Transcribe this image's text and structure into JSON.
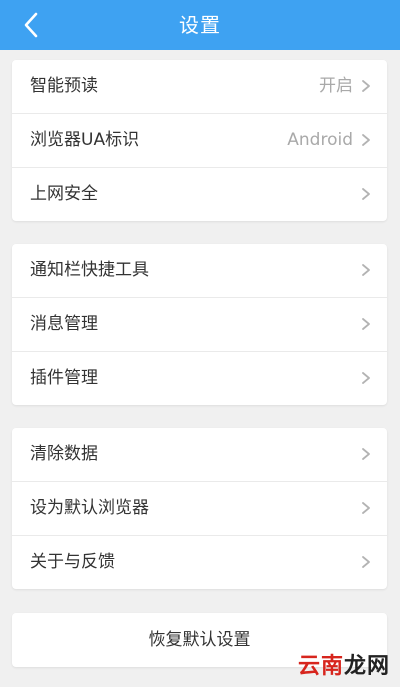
{
  "header": {
    "title": "设置",
    "back_icon": "chevron-left-icon",
    "background": "#3ea2f2"
  },
  "groups": [
    {
      "items": [
        {
          "label": "智能预读",
          "value": "开启"
        },
        {
          "label": "浏览器UA标识",
          "value": "Android"
        },
        {
          "label": "上网安全",
          "value": ""
        }
      ]
    },
    {
      "items": [
        {
          "label": "通知栏快捷工具",
          "value": ""
        },
        {
          "label": "消息管理",
          "value": ""
        },
        {
          "label": "插件管理",
          "value": ""
        }
      ]
    },
    {
      "items": [
        {
          "label": "清除数据",
          "value": ""
        },
        {
          "label": "设为默认浏览器",
          "value": ""
        },
        {
          "label": "关于与反馈",
          "value": ""
        }
      ]
    }
  ],
  "footer": {
    "restore_label": "恢复默认设置"
  },
  "watermark": {
    "part1": "云南",
    "part2": "龙网"
  },
  "icons": {
    "row_chevron": "chevron-right-icon"
  }
}
